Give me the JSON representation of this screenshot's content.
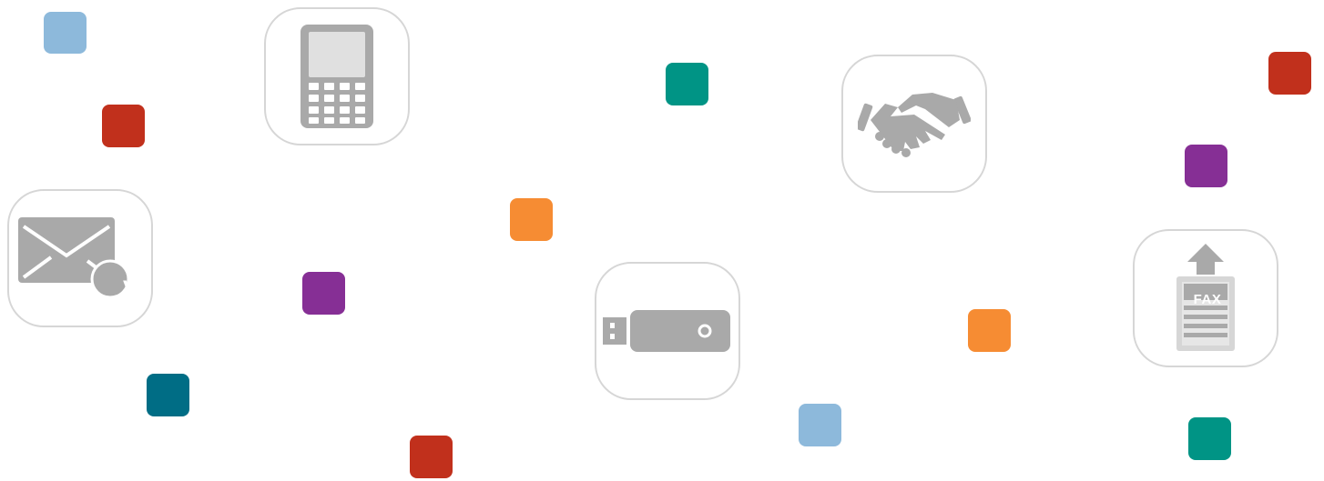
{
  "colors": {
    "light_blue": "#8db9db",
    "red": "#c1301c",
    "teal": "#009485",
    "dark_teal": "#006d85",
    "orange": "#f68c33",
    "purple": "#862f95",
    "icon_gray": "#a9a9a9",
    "card_border": "#d6d6d6"
  },
  "icons": [
    {
      "name": "calculator-icon"
    },
    {
      "name": "handshake-icon"
    },
    {
      "name": "email-verified-icon",
      "badge": "V"
    },
    {
      "name": "usb-drive-icon"
    },
    {
      "name": "fax-upload-icon",
      "label": "FAX"
    }
  ]
}
